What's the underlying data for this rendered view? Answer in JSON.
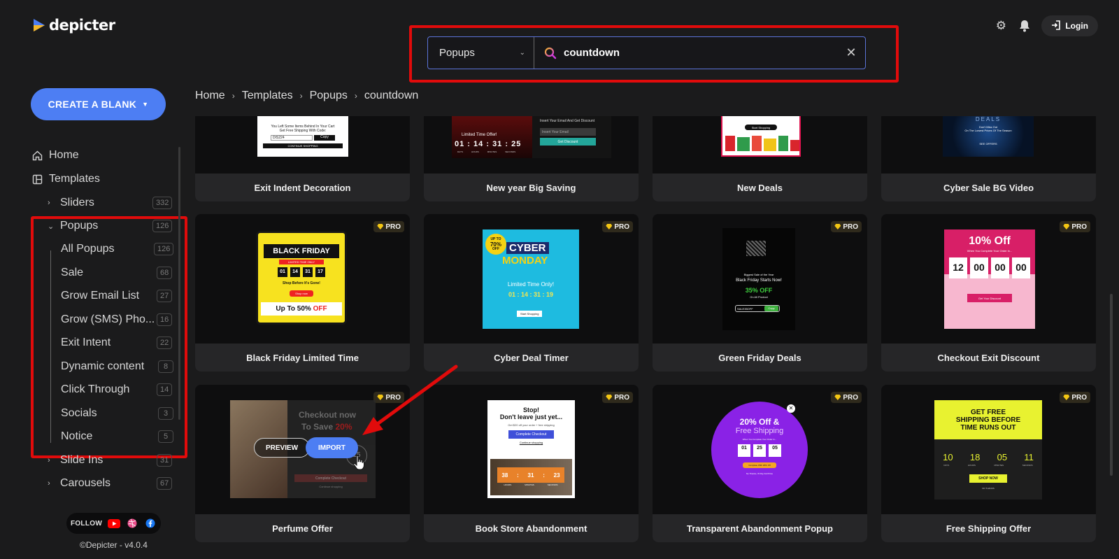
{
  "brand": {
    "name": "depicter"
  },
  "search": {
    "category": "Popups",
    "query": "countdown"
  },
  "header": {
    "login_label": "Login"
  },
  "sidebar": {
    "create_label": "CREATE A BLANK",
    "home": "Home",
    "templates": "Templates",
    "sliders": {
      "label": "Sliders",
      "count": "332"
    },
    "popups": {
      "label": "Popups",
      "count": "126"
    },
    "popup_items": [
      {
        "label": "All Popups",
        "count": "126"
      },
      {
        "label": "Sale",
        "count": "68"
      },
      {
        "label": "Grow Email List",
        "count": "27"
      },
      {
        "label": "Grow (SMS) Pho...",
        "count": "16"
      },
      {
        "label": "Exit Intent",
        "count": "22"
      },
      {
        "label": "Dynamic content",
        "count": "8"
      },
      {
        "label": "Click Through",
        "count": "14"
      },
      {
        "label": "Socials",
        "count": "3"
      },
      {
        "label": "Notice",
        "count": "5"
      }
    ],
    "slide_ins": {
      "label": "Slide Ins",
      "count": "31"
    },
    "carousels": {
      "label": "Carousels",
      "count": "67"
    },
    "follow_label": "FOLLOW",
    "version": "©Depicter - v4.0.4"
  },
  "breadcrumb": [
    "Home",
    "Templates",
    "Popups",
    "countdown"
  ],
  "pro_label": "PRO",
  "cards": [
    {
      "title": "Exit Indent Decoration"
    },
    {
      "title": "New year Big Saving"
    },
    {
      "title": "New Deals"
    },
    {
      "title": "Cyber Sale BG Video"
    },
    {
      "title": "Black Friday Limited Time"
    },
    {
      "title": "Cyber Deal Timer"
    },
    {
      "title": "Green Friday Deals"
    },
    {
      "title": "Checkout Exit Discount"
    },
    {
      "title": "Perfume Offer"
    },
    {
      "title": "Book Store Abandonment"
    },
    {
      "title": "Transparent Abandonment Popup"
    },
    {
      "title": "Free Shipping Offer"
    }
  ],
  "thumbs": {
    "exit_indent": {
      "line1": "You Left Some Items Behind In Your Cart",
      "line2": "Get Free Shipping With Code:",
      "code": "DIS224",
      "copy": "Copy",
      "cta": "CONTINUE SHOPPING"
    },
    "new_year": {
      "label": "Limited Time Offer!",
      "hint": "Insert Your Email And Get Discount",
      "field": "Insert Your Email",
      "cta": "Get Discount",
      "timer": [
        "01",
        "14",
        "31",
        "25"
      ],
      "units": [
        "DAYS",
        "HOURS",
        "MINUTES",
        "SECONDS"
      ]
    },
    "new_deals": {
      "cta": "Start Shopping"
    },
    "cyber_sale": {
      "brand": "DEALS",
      "line1": "Don't Miss Out",
      "line2": "On The Lowest Prices Of The Season",
      "cta": "SEE OFFERS"
    },
    "black_friday": {
      "title": "BLACK FRIDAY",
      "badge": "LIMITED TIME ONLY",
      "timer": [
        "01",
        "14",
        "31",
        "17"
      ],
      "sub": "Shop Before It's Gone!",
      "cta": "Shop now",
      "offer": "Up To 50% ",
      "offer_hl": "OFF"
    },
    "cyber_deal": {
      "badge_line1": "UP TO",
      "badge_line2": "70%",
      "badge_line3": "OFF",
      "line1": "CYBER",
      "line2": "MONDAY",
      "sub": "Limited Time Only!",
      "timer": "01 : 14 : 31 : 19",
      "cta": "Start Shopping"
    },
    "green_friday": {
      "line1": "Biggest Sale of the Year",
      "line2": "Black Friday Starts Now!",
      "offer": "35% OFF",
      "sub": "On All Product",
      "field": "SALE35OFF",
      "copy": "Copy"
    },
    "checkout_exit": {
      "title": "10% Off",
      "sub": "When You Complete Your Order in...",
      "timer": [
        "12",
        "00",
        "00",
        "00"
      ],
      "cta": "Get Your Discount"
    },
    "perfume": {
      "line1": "Checkout now",
      "line2": "To Save ",
      "hl": "20%",
      "partial": "15",
      "cta": "Complete Checkout",
      "link": "Continue shopping"
    },
    "book_store": {
      "line1": "Stop!",
      "line2": "Don't leave just yet...",
      "sub": "Get $20 off your order + free shipping",
      "cta": "Complete Checkout",
      "link": "Continue shopping",
      "timer": [
        "38",
        "31",
        "23"
      ],
      "units": [
        "HOURS",
        "MINUTES",
        "SECONDS"
      ]
    },
    "transparent": {
      "line1": "20% Off &",
      "line2": "Free Shipping",
      "sub": "When You Complete Your Order In...",
      "timer": [
        "01",
        "25",
        "05"
      ],
      "units": [
        "Day",
        "Minutes",
        "Seconds"
      ],
      "cta": "Complete With 20% Off",
      "link": "No Thanks, I'll Pay Full Price"
    },
    "free_shipping": {
      "line1": "GET FREE",
      "line2": "SHIPPING BEFORE",
      "line3": "TIME RUNS OUT",
      "timer": [
        "10",
        "18",
        "05",
        "11"
      ],
      "units": [
        "DAYS",
        "HOURS",
        "MINUTES",
        "SECONDS"
      ],
      "cta": "SHOP NOW",
      "link": "NO THANKS"
    }
  },
  "overlay": {
    "preview_label": "PREVIEW",
    "import_label": "IMPORT"
  },
  "colors": {
    "accent": "#4d7ef3",
    "highlight_outline": "#e10b0b",
    "background": "#1b1b1c"
  }
}
